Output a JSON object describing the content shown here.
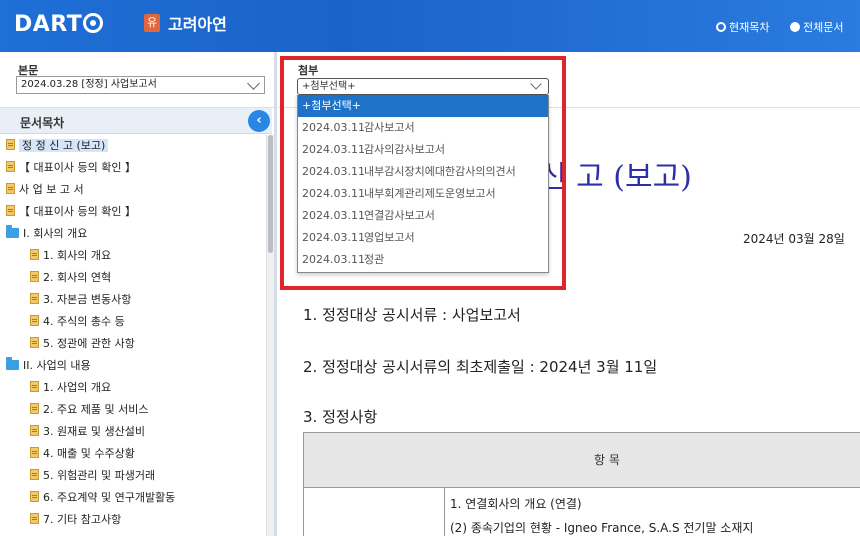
{
  "header": {
    "logo": "DART",
    "company_badge": "유",
    "company_name": "고려아연",
    "radio_current": "현재목차",
    "radio_all": "전체문서"
  },
  "main_doc": {
    "label": "본문",
    "selected": "2024.03.28 [정정] 사업보고서"
  },
  "attachment": {
    "label": "첨부",
    "selected": "+첨부선택+",
    "options": [
      {
        "date": "",
        "name": "+첨부선택+",
        "active": true
      },
      {
        "date": "2024.03.11",
        "name": "감사보고서"
      },
      {
        "date": "2024.03.11",
        "name": "감사의감사보고서"
      },
      {
        "date": "2024.03.11",
        "name": "내부감시장치에대한감사의의견서"
      },
      {
        "date": "2024.03.11",
        "name": "내부회계관리제도운영보고서"
      },
      {
        "date": "2024.03.11",
        "name": "연결감사보고서"
      },
      {
        "date": "2024.03.11",
        "name": "영업보고서"
      },
      {
        "date": "2024.03.11",
        "name": "정관"
      }
    ]
  },
  "toc": {
    "title": "문서목차",
    "items": [
      {
        "label": "정 정 신 고 (보고)",
        "type": "doc",
        "level": 0,
        "selected": true
      },
      {
        "label": "【 대표이사 등의 확인 】",
        "type": "doc",
        "level": 0
      },
      {
        "label": "사 업 보 고 서",
        "type": "doc",
        "level": 0
      },
      {
        "label": "【 대표이사 등의 확인 】",
        "type": "doc",
        "level": 0
      },
      {
        "label": "I. 회사의 개요",
        "type": "folder",
        "level": 0
      },
      {
        "label": "1. 회사의 개요",
        "type": "doc",
        "level": 1
      },
      {
        "label": "2. 회사의 연혁",
        "type": "doc",
        "level": 1
      },
      {
        "label": "3. 자본금 변동사항",
        "type": "doc",
        "level": 1
      },
      {
        "label": "4. 주식의 총수 등",
        "type": "doc",
        "level": 1
      },
      {
        "label": "5. 정관에 관한 사항",
        "type": "doc",
        "level": 1
      },
      {
        "label": "II. 사업의 내용",
        "type": "folder",
        "level": 0
      },
      {
        "label": "1. 사업의 개요",
        "type": "doc",
        "level": 1
      },
      {
        "label": "2. 주요 제품 및 서비스",
        "type": "doc",
        "level": 1
      },
      {
        "label": "3. 원재료 및 생산설비",
        "type": "doc",
        "level": 1
      },
      {
        "label": "4. 매출 및 수주상황",
        "type": "doc",
        "level": 1
      },
      {
        "label": "5. 위험관리 및 파생거래",
        "type": "doc",
        "level": 1
      },
      {
        "label": "6. 주요계약 및 연구개발활동",
        "type": "doc",
        "level": 1
      },
      {
        "label": "7. 기타 참고사항",
        "type": "doc",
        "level": 1
      }
    ]
  },
  "document": {
    "title_partial": "신 고 (보고)",
    "date": "2024년 03월 28일",
    "line1": "1. 정정대상 공시서류 : 사업보고서",
    "line2": "2. 정정대상 공시서류의 최초제출일 : 2024년 3월 11일",
    "line3": "3. 정정사항",
    "table_header": "항 목",
    "row_line1": "1. 연결회사의 개요 (연결)",
    "row_line2": "(2) 종속기업의 현황 - Igneo France, S.A.S 전기말 소재지"
  },
  "colors": {
    "header_blue": "#1f6fd6",
    "highlight_red": "#e0242b",
    "title_blue": "#2d2fa8",
    "dropdown_active": "#1e73c8"
  }
}
